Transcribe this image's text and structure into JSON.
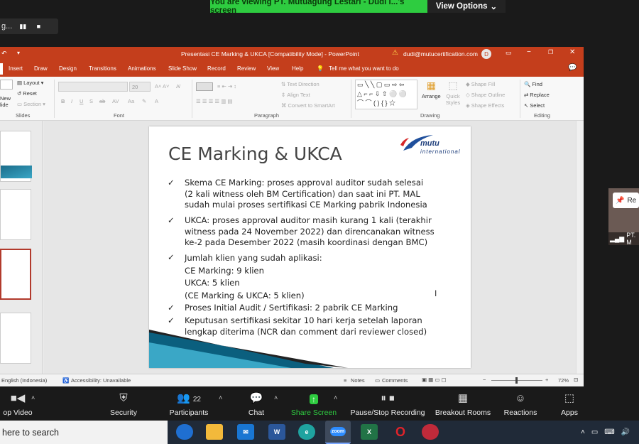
{
  "zoom": {
    "banner_text": "You are viewing PT. Mutuagung Lestari - Dudi I...'s screen",
    "view_options": "View Options",
    "recording_label": "g...",
    "participant_label": "PT. M",
    "participant_badge": "Re",
    "toolbar": {
      "stop_video": "op Video",
      "security": "Security",
      "participants": "Participants",
      "participants_count": "22",
      "chat": "Chat",
      "share_screen": "Share Screen",
      "recording": "Pause/Stop Recording",
      "breakout": "Breakout Rooms",
      "reactions": "Reactions",
      "apps": "Apps"
    }
  },
  "ppt": {
    "title": "Presentasi CE Marking & UKCA [Compatibility Mode]  -  PowerPoint",
    "user_email": "dudi@mutucertification.com",
    "user_initial": "D",
    "tabs": [
      "Insert",
      "Draw",
      "Design",
      "Transitions",
      "Animations",
      "Slide Show",
      "Record",
      "Review",
      "View",
      "Help"
    ],
    "tell_me": "Tell me what you want to do",
    "ribbon": {
      "new_slide": "New\nlide",
      "layout": "Layout",
      "reset": "Reset",
      "section": "Section",
      "slides_label": "Slides",
      "font_size": "20",
      "font_label": "Font",
      "text_direction": "Text Direction",
      "align_text": "Align Text",
      "convert_smartart": "Convert to SmartArt",
      "paragraph_label": "Paragraph",
      "arrange": "Arrange",
      "quick_styles": "Quick Styles",
      "shape_fill": "Shape Fill",
      "shape_outline": "Shape Outline",
      "shape_effects": "Shape Effects",
      "drawing_label": "Drawing",
      "find": "Find",
      "replace": "Replace",
      "select": "Select",
      "editing_label": "Editing"
    },
    "slide": {
      "title": "CE Marking & UKCA",
      "logo_main": "mutu",
      "logo_sub": "international",
      "bullets": [
        {
          "lines": [
            "Skema CE Marking: proses approval auditor sudah selesai",
            "(2 kali witness oleh BM Certification) dan saat ini PT. MAL",
            "sudah mulai proses sertifikasi CE Marking pabrik Indonesia"
          ]
        },
        {
          "lines": [
            "UKCA: proses approval auditor masih kurang 1 kali (terakhir",
            "witness pada 24 November 2022) dan direncanakan witness",
            "ke-2 pada Desember 2022 (masih koordinasi dengan BMC)"
          ]
        },
        {
          "lines": [
            "Jumlah klien yang sudah aplikasi:",
            "CE Marking: 9 klien",
            "UKCA: 5 klien",
            "(CE Marking & UKCA: 5 klien)"
          ]
        },
        {
          "lines": [
            "Proses Initial Audit / Sertifikasi: 2 pabrik CE Marking"
          ]
        },
        {
          "lines": [
            "Keputusan sertifikasi sekitar 10 hari kerja setelah laporan",
            "lengkap diterima (NCR dan comment dari reviewer closed)"
          ]
        }
      ]
    },
    "status": {
      "language": "English (Indonesia)",
      "accessibility": "Accessibility: Unavailable",
      "notes": "Notes",
      "comments": "Comments",
      "zoom_level": "72%"
    }
  },
  "taskbar": {
    "search_placeholder": "here to search",
    "apps": [
      "outlook-blue-icon",
      "file-explorer-icon",
      "mail-icon",
      "word-icon",
      "edge-icon",
      "zoom-icon",
      "excel-icon",
      "opera-icon",
      "app-icon"
    ]
  }
}
